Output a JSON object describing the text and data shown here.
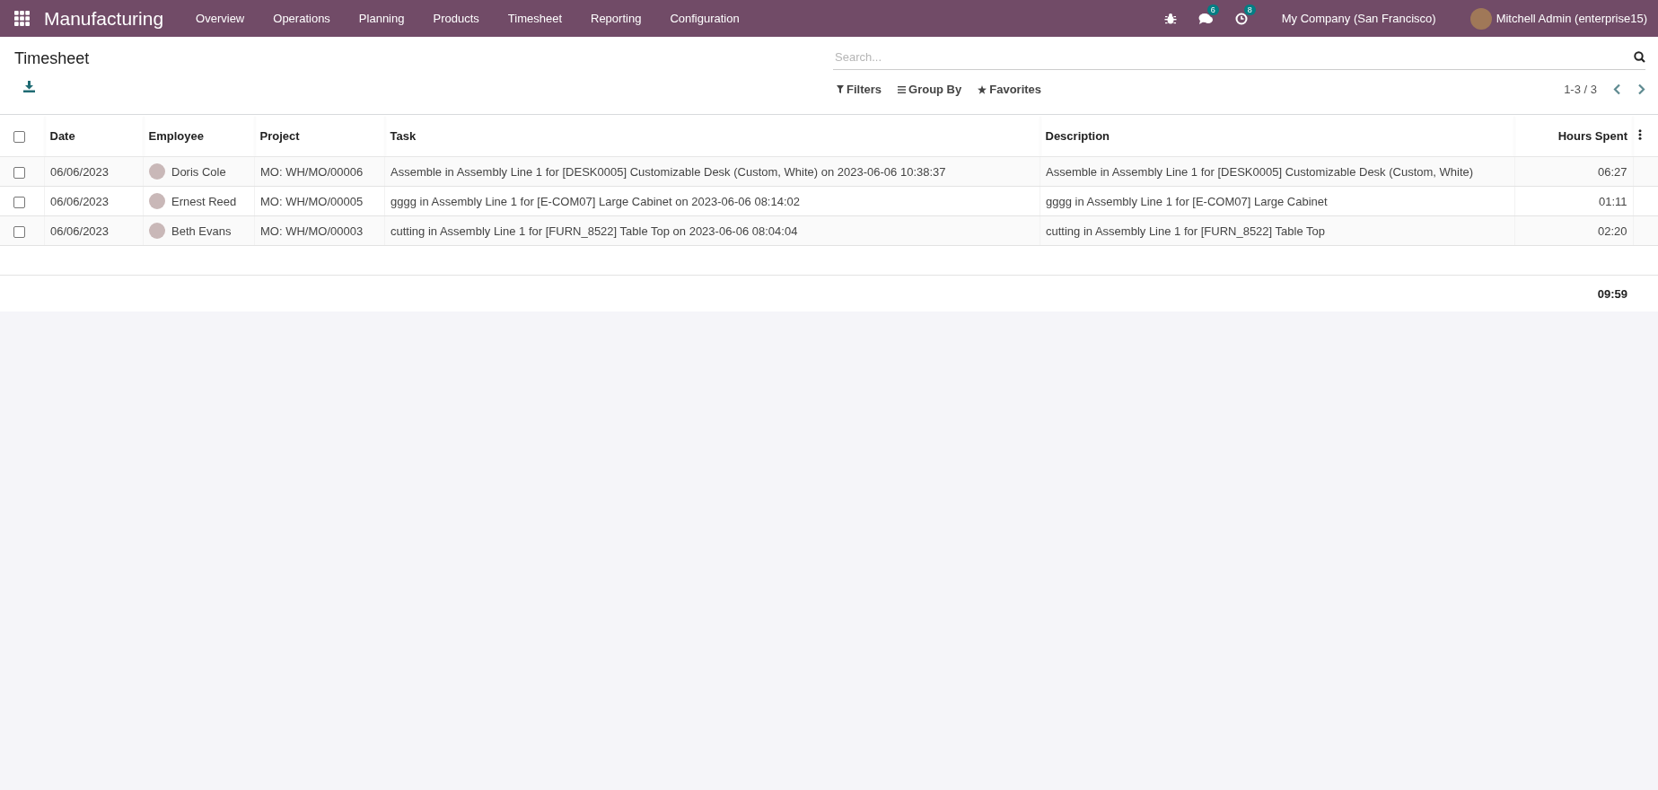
{
  "navbar": {
    "app_name": "Manufacturing",
    "menu": [
      "Overview",
      "Operations",
      "Planning",
      "Products",
      "Timesheet",
      "Reporting",
      "Configuration"
    ],
    "messages_count": "6",
    "activities_count": "8",
    "company": "My Company (San Francisco)",
    "user": "Mitchell Admin (enterprise15)"
  },
  "control_panel": {
    "title": "Timesheet",
    "search": {
      "placeholder": "Search..."
    },
    "filters": [
      "Filters",
      "Group By",
      "Favorites"
    ],
    "pager": "1-3 / 3"
  },
  "table": {
    "select_all_checked": false,
    "columns": [
      "Date",
      "Employee",
      "Project",
      "Task",
      "Description",
      "Hours Spent"
    ],
    "rows": [
      {
        "checked": false,
        "date": "06/06/2023",
        "employee": "Doris Cole",
        "project": "MO: WH/MO/00006",
        "task": "Assemble in Assembly Line 1 for [DESK0005] Customizable Desk (Custom, White) on 2023-06-06 10:38:37",
        "description": "Assemble in Assembly Line 1 for [DESK0005] Customizable Desk (Custom, White)",
        "hours": "06:27"
      },
      {
        "checked": false,
        "date": "06/06/2023",
        "employee": "Ernest Reed",
        "project": "MO: WH/MO/00005",
        "task": "gggg in Assembly Line 1 for [E-COM07] Large Cabinet on 2023-06-06 08:14:02",
        "description": "gggg in Assembly Line 1 for [E-COM07] Large Cabinet",
        "hours": "01:11"
      },
      {
        "checked": false,
        "date": "06/06/2023",
        "employee": "Beth Evans",
        "project": "MO: WH/MO/00003",
        "task": "cutting in Assembly Line 1 for [FURN_8522] Table Top on 2023-06-06 08:04:04",
        "description": "cutting in Assembly Line 1 for [FURN_8522] Table Top",
        "hours": "02:20"
      }
    ],
    "total_hours": "09:59"
  }
}
